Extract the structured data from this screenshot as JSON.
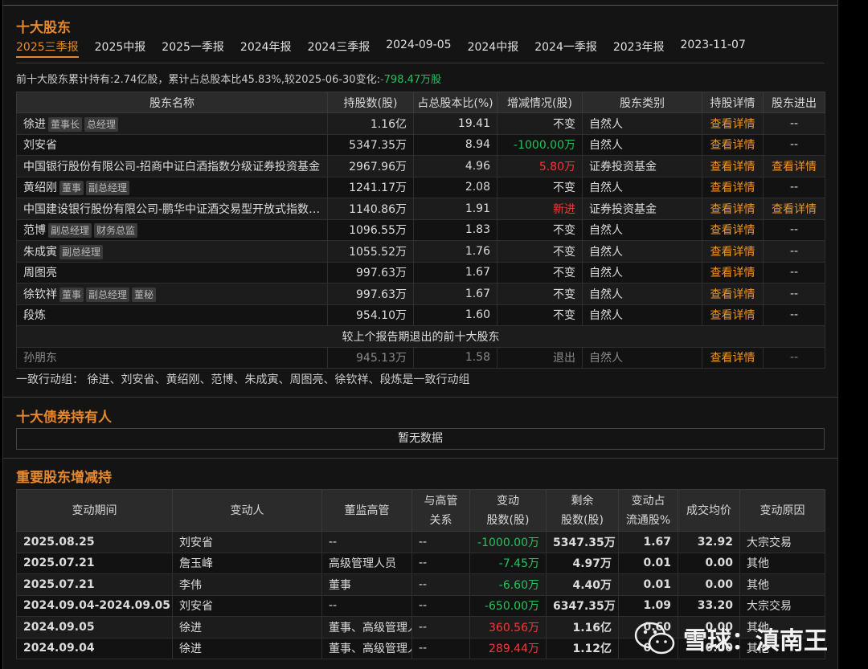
{
  "top_holders": {
    "title": "十大股东",
    "tabs": [
      "2025三季报",
      "2025中报",
      "2025一季报",
      "2024年报",
      "2024三季报",
      "2024-09-05",
      "2024中报",
      "2024一季报",
      "2023年报",
      "2023-11-07"
    ],
    "active_tab": 0,
    "summary_prefix": "前十大股东累计持有:2.74亿股，累计占总股本比45.83%,较2025-06-30变化:",
    "summary_change": "-798.47万股",
    "columns": [
      "股东名称",
      "持股数(股)",
      "占总股本比(%)",
      "增减情况(股)",
      "股东类别",
      "持股详情",
      "股东进出"
    ],
    "rows": [
      {
        "name": "徐进",
        "tags": [
          "董事长",
          "总经理"
        ],
        "shares": "1.16亿",
        "ratio": "19.41",
        "change": "不变",
        "change_color": "normal",
        "type": "自然人",
        "detail": "查看详情",
        "inout": "--"
      },
      {
        "name": "刘安省",
        "tags": [],
        "shares": "5347.35万",
        "ratio": "8.94",
        "change": "-1000.00万",
        "change_color": "green",
        "type": "自然人",
        "detail": "查看详情",
        "inout": "--"
      },
      {
        "name": "中国银行股份有限公司-招商中证白酒指数分级证券投资基金",
        "tags": [],
        "shares": "2967.96万",
        "ratio": "4.96",
        "change": "5.80万",
        "change_color": "red",
        "type": "证券投资基金",
        "detail": "查看详情",
        "inout": "查看详情"
      },
      {
        "name": "黄绍刚",
        "tags": [
          "董事",
          "副总经理"
        ],
        "shares": "1241.17万",
        "ratio": "2.08",
        "change": "不变",
        "change_color": "normal",
        "type": "自然人",
        "detail": "查看详情",
        "inout": "--"
      },
      {
        "name": "中国建设银行股份有限公司-鹏华中证酒交易型开放式指数证券投资基金",
        "tags": [],
        "shares": "1140.86万",
        "ratio": "1.91",
        "change": "新进",
        "change_color": "red",
        "type": "证券投资基金",
        "detail": "查看详情",
        "inout": "查看详情"
      },
      {
        "name": "范博",
        "tags": [
          "副总经理",
          "财务总监"
        ],
        "shares": "1096.55万",
        "ratio": "1.83",
        "change": "不变",
        "change_color": "normal",
        "type": "自然人",
        "detail": "查看详情",
        "inout": "--"
      },
      {
        "name": "朱成寅",
        "tags": [
          "副总经理"
        ],
        "shares": "1055.52万",
        "ratio": "1.76",
        "change": "不变",
        "change_color": "normal",
        "type": "自然人",
        "detail": "查看详情",
        "inout": "--"
      },
      {
        "name": "周图亮",
        "tags": [],
        "shares": "997.63万",
        "ratio": "1.67",
        "change": "不变",
        "change_color": "normal",
        "type": "自然人",
        "detail": "查看详情",
        "inout": "--"
      },
      {
        "name": "徐钦祥",
        "tags": [
          "董事",
          "副总经理",
          "董秘"
        ],
        "shares": "997.63万",
        "ratio": "1.67",
        "change": "不变",
        "change_color": "normal",
        "type": "自然人",
        "detail": "查看详情",
        "inout": "--"
      },
      {
        "name": "段炼",
        "tags": [],
        "shares": "954.10万",
        "ratio": "1.60",
        "change": "不变",
        "change_color": "normal",
        "type": "自然人",
        "detail": "查看详情",
        "inout": "--"
      }
    ],
    "exited_header": "较上个报告期退出的前十大股东",
    "exited_rows": [
      {
        "name": "孙朋东",
        "shares": "945.13万",
        "ratio": "1.58",
        "change": "退出",
        "type": "自然人",
        "detail": "查看详情",
        "inout": "--"
      }
    ],
    "concert_note": "一致行动组： 徐进、刘安省、黄绍刚、范博、朱成寅、周图亮、徐钦祥、段炼是一致行动组"
  },
  "bond_holders": {
    "title": "十大债券持有人",
    "empty_text": "暂无数据"
  },
  "changes": {
    "title": "重要股东增减持",
    "columns": [
      [
        "变动期间"
      ],
      [
        "变动人"
      ],
      [
        "董监高管"
      ],
      [
        "与高管",
        "关系"
      ],
      [
        "变动",
        "股数(股)"
      ],
      [
        "剩余",
        "股数(股)"
      ],
      [
        "变动占",
        "流通股%"
      ],
      [
        "成交均价"
      ],
      [
        "变动原因"
      ]
    ],
    "rows": [
      {
        "period": "2025.08.25",
        "person": "刘安省",
        "role": "--",
        "relation": "--",
        "delta": "-1000.00万",
        "delta_color": "green",
        "remain": "5347.35万",
        "pct": "1.67",
        "price": "32.92",
        "reason": "大宗交易"
      },
      {
        "period": "2025.07.21",
        "person": "詹玉峰",
        "role": "高级管理人员",
        "relation": "--",
        "delta": "-7.45万",
        "delta_color": "green",
        "remain": "4.97万",
        "pct": "0.01",
        "price": "0.00",
        "reason": "其他"
      },
      {
        "period": "2025.07.21",
        "person": "李伟",
        "role": "董事",
        "relation": "--",
        "delta": "-6.60万",
        "delta_color": "green",
        "remain": "4.40万",
        "pct": "0.01",
        "price": "0.00",
        "reason": "其他"
      },
      {
        "period": "2024.09.04-2024.09.05",
        "person": "刘安省",
        "role": "--",
        "relation": "--",
        "delta": "-650.00万",
        "delta_color": "green",
        "remain": "6347.35万",
        "pct": "1.09",
        "price": "33.20",
        "reason": "大宗交易"
      },
      {
        "period": "2024.09.05",
        "person": "徐进",
        "role": "董事、高级管理人员",
        "relation": "--",
        "delta": "360.56万",
        "delta_color": "red",
        "remain": "1.16亿",
        "pct": "0.60",
        "price": "0.00",
        "reason": "其他"
      },
      {
        "period": "2024.09.04",
        "person": "徐进",
        "role": "董事、高级管理人员",
        "relation": "--",
        "delta": "289.44万",
        "delta_color": "red",
        "remain": "1.12亿",
        "pct": "0.50",
        "price": "0.00",
        "reason": "其他"
      }
    ]
  },
  "watermark": {
    "text": "雪球：滇南王",
    "icon": "wechat-icon"
  }
}
